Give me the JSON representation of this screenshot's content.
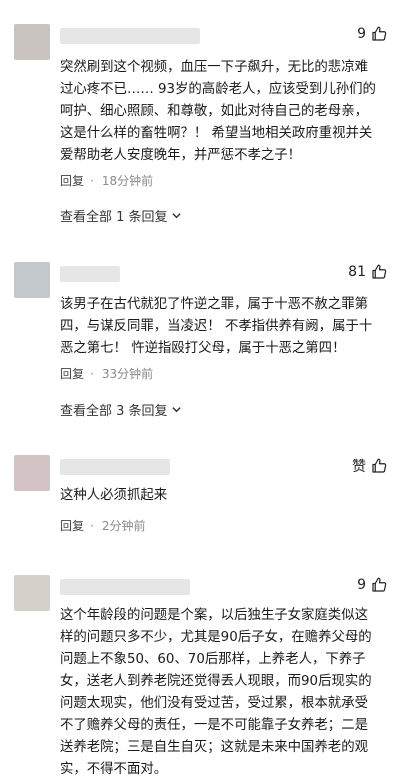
{
  "comments": [
    {
      "likes": "9",
      "text": "突然刷到这个视频，血压一下子飙升，无比的悲凉难\n过心疼不已…… 93岁的高龄老人，应该受到儿孙们的\n呵护、细心照顾、和尊敬，如此对待自己的老母亲，\n这是什么样的畜牲啊？！ 希望当地相关政府重视并关\n爱帮助老人安度晚年，并严惩不孝之子！",
      "reply_label": "回复",
      "time": "18分钟前",
      "replies_label": "查看全部 1 条回复",
      "avatar_color": "#c9c4bf"
    },
    {
      "likes": "81",
      "text": "该男子在古代就犯了忤逆之罪，属于十恶不赦之罪第\n四，与谋反同罪，当凌迟！ 不孝指供养有阙，属于十\n恶之第七！ 忤逆指殴打父母，属于十恶之第四！",
      "reply_label": "回复",
      "time": "33分钟前",
      "replies_label": "查看全部 3 条回复",
      "avatar_color": "#c3c8cc"
    },
    {
      "likes": "赞",
      "text": "这种人必须抓起来",
      "reply_label": "回复",
      "time": "2分钟前",
      "avatar_color": "#d3c3c4"
    },
    {
      "likes": "9",
      "text": "这个年龄段的问题是个案，以后独生子女家庭类似这\n样的问题只多不少，尤其是90后子女，在赡养父母的\n问题上不象50、60、70后那样，上养老人，下养子\n女，送老人到养老院还觉得丢人现眼，而90后现实的\n问题太现实，他们没有受过苦，受过累，根本就承受\n不了赡养父母的责任，一是不可能靠子女养老；二是\n送养老院；三是自生自灭；这就是未来中国养老的观\n实，不得不面对。",
      "avatar_color": "#d6d0cb"
    }
  ]
}
